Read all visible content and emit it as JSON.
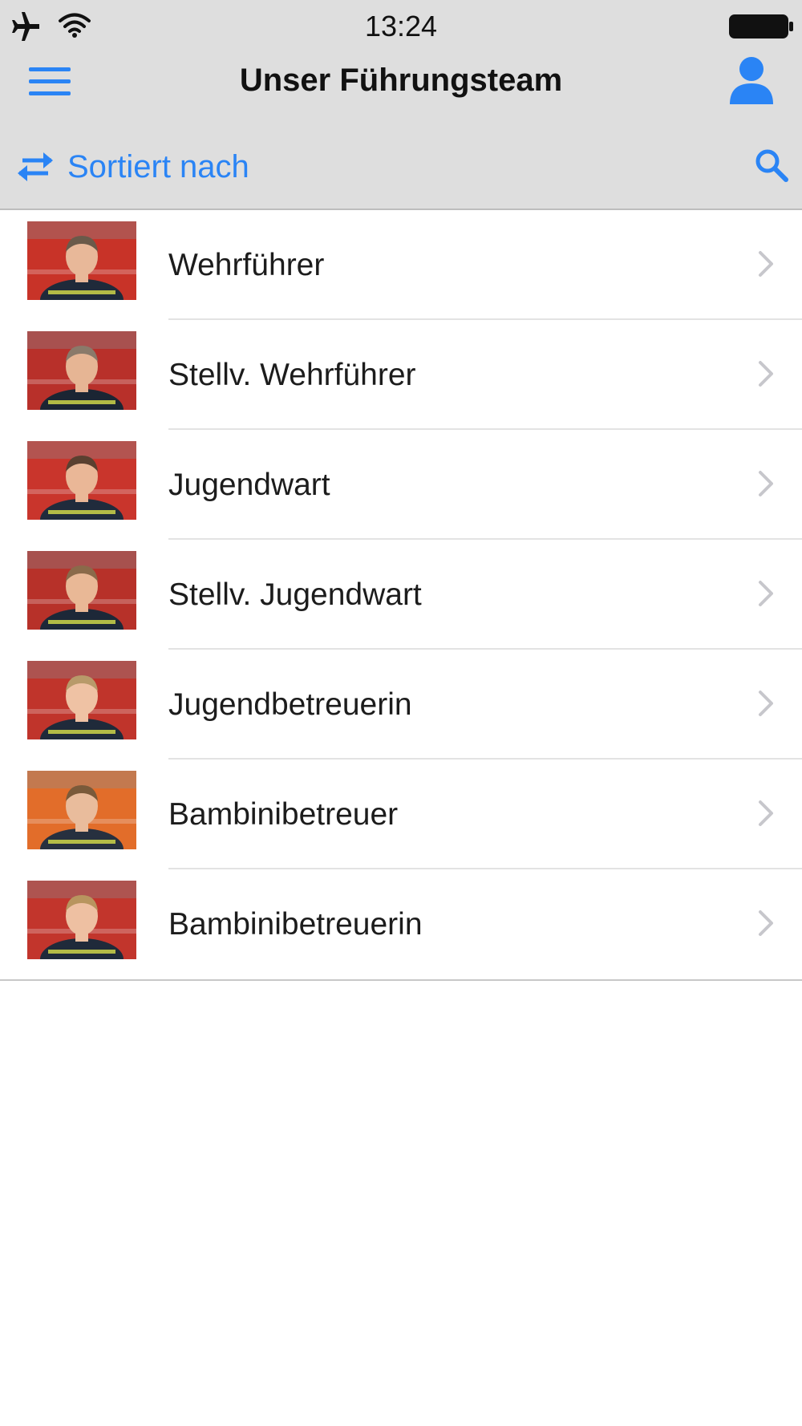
{
  "status_bar": {
    "time": "13:24",
    "icons": [
      "airplane-icon",
      "wifi-icon",
      "battery-icon"
    ]
  },
  "nav": {
    "title": "Unser Führungsteam",
    "left_icon": "menu-icon",
    "right_icon": "user-icon"
  },
  "sortbar": {
    "sort_label": "Sortiert nach",
    "sort_icon": "swap-icon",
    "search_icon": "search-icon"
  },
  "colors": {
    "accent": "#2a84f5",
    "header_background": "#dedede",
    "chevron": "#c7c7cc"
  },
  "list": {
    "items": [
      {
        "label": "Wehrführer",
        "thumb": "photo-wehrfuehrer"
      },
      {
        "label": "Stellv. Wehrführer",
        "thumb": "photo-stellv-wehrfuehrer"
      },
      {
        "label": "Jugendwart",
        "thumb": "photo-jugendwart"
      },
      {
        "label": "Stellv. Jugendwart",
        "thumb": "photo-stellv-jugendwart"
      },
      {
        "label": "Jugendbetreuerin",
        "thumb": "photo-jugendbetreuerin"
      },
      {
        "label": "Bambinibetreuer",
        "thumb": "photo-bambinibetreuer"
      },
      {
        "label": "Bambinibetreuerin",
        "thumb": "photo-bambinibetreuerin"
      }
    ]
  }
}
